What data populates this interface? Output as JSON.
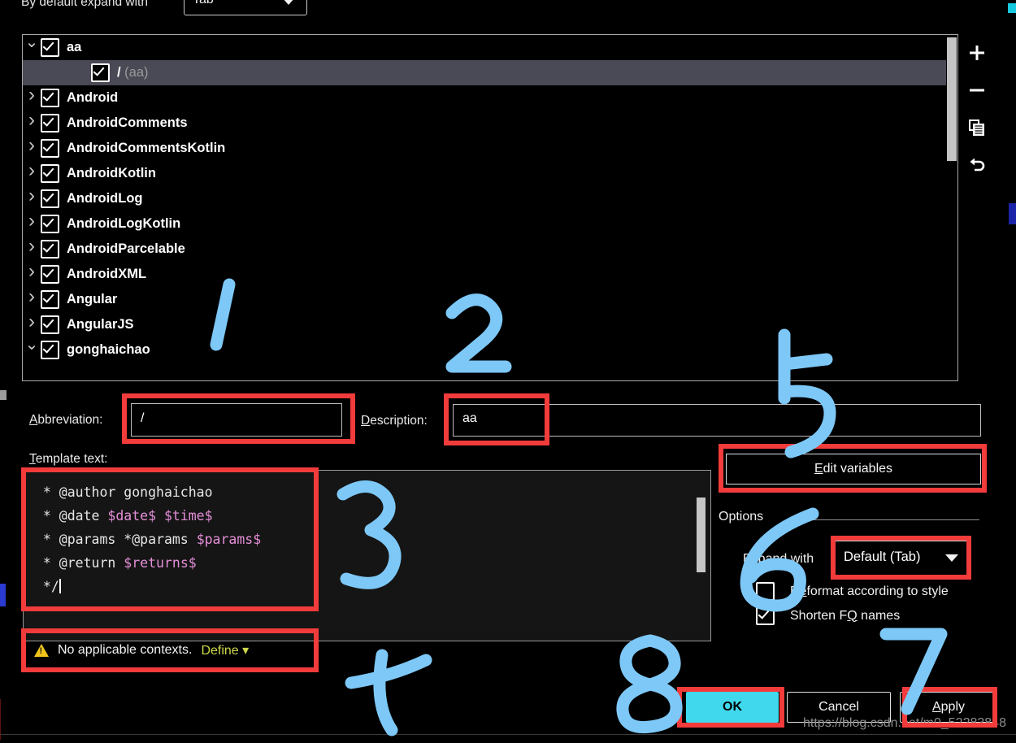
{
  "top": {
    "label": "By default expand with",
    "select_value": "Tab"
  },
  "tree": {
    "rows": [
      {
        "label": "aa",
        "arrow": "down",
        "checked": true,
        "indent": 0,
        "selected": false,
        "suffix": ""
      },
      {
        "label": "/",
        "arrow": "none",
        "checked": true,
        "indent": 2,
        "selected": true,
        "suffix": "(aa)"
      },
      {
        "label": "Android",
        "arrow": "right",
        "checked": true,
        "indent": 0,
        "selected": false,
        "suffix": ""
      },
      {
        "label": "AndroidComments",
        "arrow": "right",
        "checked": true,
        "indent": 0,
        "selected": false,
        "suffix": ""
      },
      {
        "label": "AndroidCommentsKotlin",
        "arrow": "right",
        "checked": true,
        "indent": 0,
        "selected": false,
        "suffix": ""
      },
      {
        "label": "AndroidKotlin",
        "arrow": "right",
        "checked": true,
        "indent": 0,
        "selected": false,
        "suffix": ""
      },
      {
        "label": "AndroidLog",
        "arrow": "right",
        "checked": true,
        "indent": 0,
        "selected": false,
        "suffix": ""
      },
      {
        "label": "AndroidLogKotlin",
        "arrow": "right",
        "checked": true,
        "indent": 0,
        "selected": false,
        "suffix": ""
      },
      {
        "label": "AndroidParcelable",
        "arrow": "right",
        "checked": true,
        "indent": 0,
        "selected": false,
        "suffix": ""
      },
      {
        "label": "AndroidXML",
        "arrow": "right",
        "checked": true,
        "indent": 0,
        "selected": false,
        "suffix": ""
      },
      {
        "label": "Angular",
        "arrow": "right",
        "checked": true,
        "indent": 0,
        "selected": false,
        "suffix": ""
      },
      {
        "label": "AngularJS",
        "arrow": "right",
        "checked": true,
        "indent": 0,
        "selected": false,
        "suffix": ""
      },
      {
        "label": "gonghaichao",
        "arrow": "down",
        "checked": true,
        "indent": 0,
        "selected": false,
        "suffix": ""
      }
    ]
  },
  "rail": {
    "add": "add-icon",
    "remove": "remove-icon",
    "duplicate": "duplicate-icon",
    "revert": "revert-icon"
  },
  "fields": {
    "abbreviation_label": "Abbreviation:",
    "abbreviation_value": "/",
    "description_label": "Description:",
    "description_value": "aa",
    "template_label": "Template text:"
  },
  "template_text": {
    "lines": [
      [
        {
          "t": " * @author gonghaichao",
          "k": "plain"
        }
      ],
      [
        {
          "t": " * @date ",
          "k": "plain"
        },
        {
          "t": "$date$ $time$",
          "k": "var"
        }
      ],
      [
        {
          "t": " * @params *@params ",
          "k": "plain"
        },
        {
          "t": "$params$",
          "k": "var"
        }
      ],
      [
        {
          "t": " * @return ",
          "k": "plain"
        },
        {
          "t": "$returns$",
          "k": "var"
        }
      ],
      [
        {
          "t": " */",
          "k": "plain"
        },
        {
          "t": "|",
          "k": "caret"
        }
      ]
    ]
  },
  "warning": {
    "text": "No applicable contexts.",
    "action": "Define",
    "icon": "warning-triangle-icon",
    "chevron": "chevron-down-icon"
  },
  "options": {
    "edit_variables": "Edit variables",
    "edit_variables_mnemonic": "E",
    "group_title": "Options",
    "expand_with_label": "Expand with",
    "expand_with_value": "Default (Tab)",
    "reformat_label": "Reformat according to style",
    "reformat_checked": false,
    "shorten_label": "Shorten FQ names",
    "shorten_checked": true
  },
  "buttons": {
    "ok": "OK",
    "cancel": "Cancel",
    "apply": "Apply",
    "apply_mnemonic": "A"
  },
  "watermark": "https://blog.csdn.net/m0_52283848",
  "annotations": {
    "numbers": [
      "1",
      "2",
      "3",
      "4",
      "5",
      "6",
      "7",
      "8"
    ],
    "box_color": "#f23b3b",
    "pen_color": "#7dc8f7"
  },
  "colors": {
    "background": "#000000",
    "selection": "#4a4a56",
    "variable_token": "#e58fd8",
    "define_link": "#cfd84a",
    "ok_highlight": "#3fd8ec",
    "warning_icon": "#f0c419"
  }
}
